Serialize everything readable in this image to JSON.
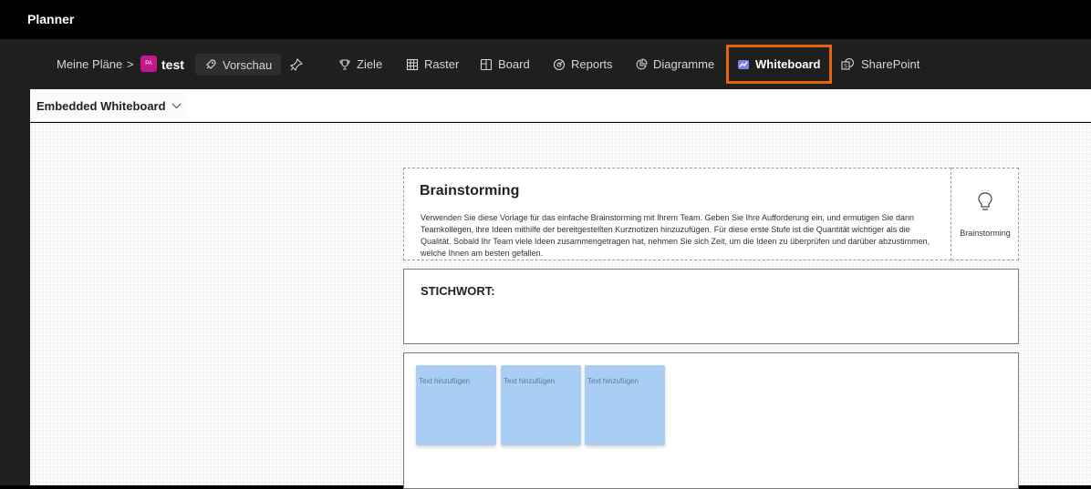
{
  "app": {
    "title": "Planner"
  },
  "breadcrumb": {
    "root": "Meine Pläne",
    "separator": ">",
    "plan_badge": "PA",
    "plan_name": "test",
    "preview": "Vorschau"
  },
  "tabs": [
    {
      "label": "Ziele",
      "icon": "trophy-icon"
    },
    {
      "label": "Raster",
      "icon": "grid-icon"
    },
    {
      "label": "Board",
      "icon": "board-icon"
    },
    {
      "label": "Reports",
      "icon": "reports-icon"
    },
    {
      "label": "Diagramme",
      "icon": "chart-icon"
    },
    {
      "label": "Whiteboard",
      "icon": "whiteboard-icon",
      "active": true
    },
    {
      "label": "SharePoint",
      "icon": "sharepoint-icon"
    }
  ],
  "toolbar": {
    "selector_label": "Embedded Whiteboard"
  },
  "whiteboard": {
    "brainstorm_title": "Brainstorming",
    "brainstorm_text": "Verwenden Sie diese Vorlage für das einfache Brainstorming mit Ihrem Team. Geben Sie Ihre Aufforderung ein, und ermutigen Sie dann Teamkollegen, ihre Ideen mithilfe der bereitgestellten Kurznotizen hinzuzufügen. Für diese erste Stufe ist die Quantität wichtiger als die Qualität. Sobald Ihr Team viele Ideen zusammengetragen hat, nehmen Sie sich Zeit, um die Ideen zu überprüfen und darüber abzustimmen, welche Ihnen am besten gefallen.",
    "side_label": "Brainstorming",
    "keyword_label": "STICHWORT:",
    "notes": [
      "Text hinzufügen",
      "Text hinzufügen",
      "Text hinzufügen"
    ]
  },
  "colors": {
    "accent_highlight": "#e8620e",
    "note_fill": "#a9cdf3",
    "plan_badge": "#c2188b"
  }
}
